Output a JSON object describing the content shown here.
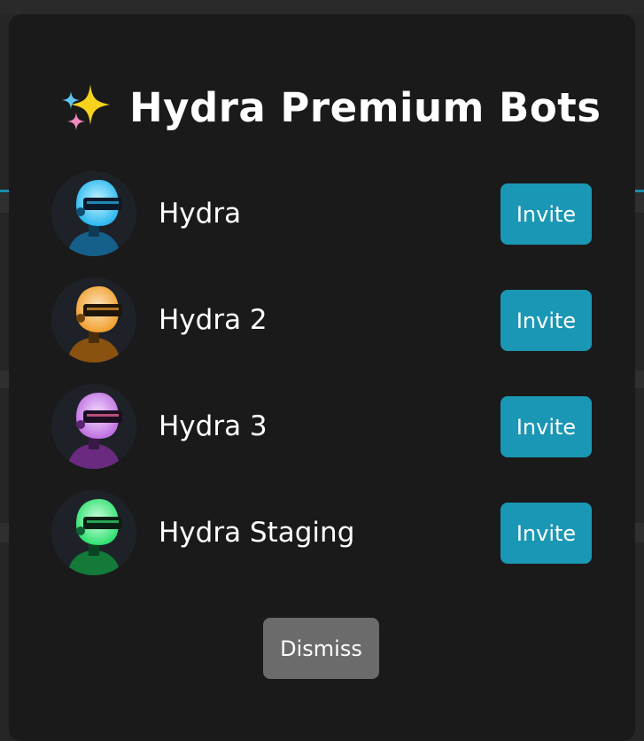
{
  "modal": {
    "title": "Hydra Premium Bots",
    "title_icon": "sparkles-icon",
    "bots": [
      {
        "name": "Hydra",
        "action_label": "Invite",
        "accent": "#2bb8f0"
      },
      {
        "name": "Hydra 2",
        "action_label": "Invite",
        "accent": "#f0a030"
      },
      {
        "name": "Hydra 3",
        "action_label": "Invite",
        "accent": "#c070e0"
      },
      {
        "name": "Hydra Staging",
        "action_label": "Invite",
        "accent": "#30e070"
      }
    ],
    "dismiss_label": "Dismiss"
  },
  "colors": {
    "modal_bg": "#1a1a1a",
    "invite_button": "#1a97b5",
    "dismiss_button": "#6b6b6b",
    "text": "#ffffff"
  }
}
